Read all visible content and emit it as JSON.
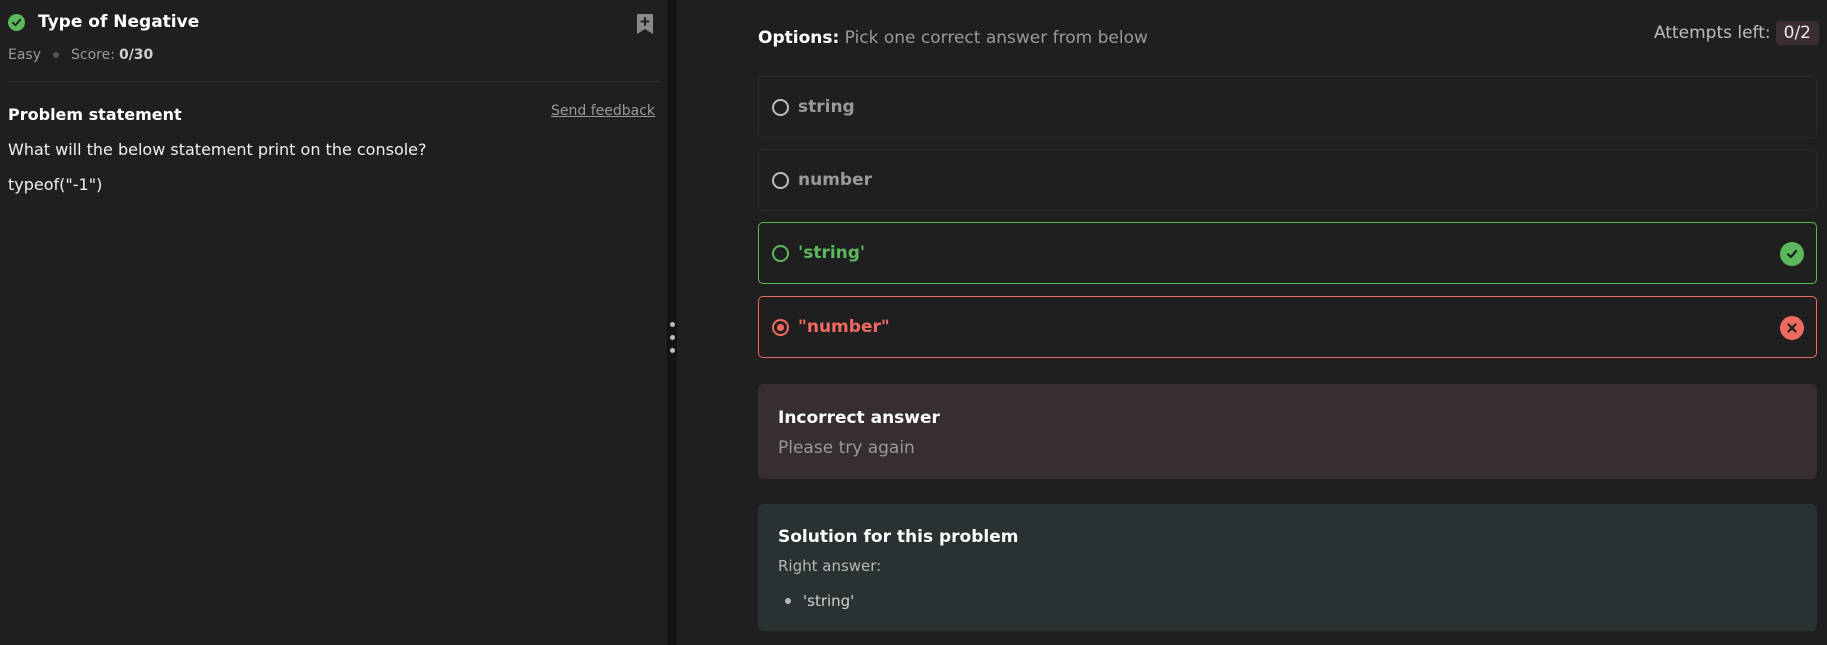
{
  "problem": {
    "title": "Type of Negative",
    "difficulty": "Easy",
    "score_label": "Score:",
    "score_value": "0/30",
    "statement_heading": "Problem statement",
    "feedback_link": "Send feedback",
    "question": "What will the below statement print on the console?",
    "code": "typeof(\"-1\")"
  },
  "options": {
    "label_bold": "Options:",
    "label_text": " Pick one correct answer from below",
    "attempts_label": "Attempts left:",
    "attempts_value": "0/2",
    "items": [
      {
        "text": "string",
        "state": "neutral"
      },
      {
        "text": "number",
        "state": "neutral"
      },
      {
        "text": "'string'",
        "state": "correct"
      },
      {
        "text": "\"number\"",
        "state": "selected-wrong"
      }
    ]
  },
  "result": {
    "heading": "Incorrect answer",
    "subtext": "Please try again"
  },
  "solution": {
    "heading": "Solution for this problem",
    "right_answer_label": "Right answer:",
    "answers": [
      "'string'"
    ]
  },
  "colors": {
    "correct": "#5cb85c",
    "wrong": "#f06a5f",
    "background": "#1f1f1f"
  }
}
